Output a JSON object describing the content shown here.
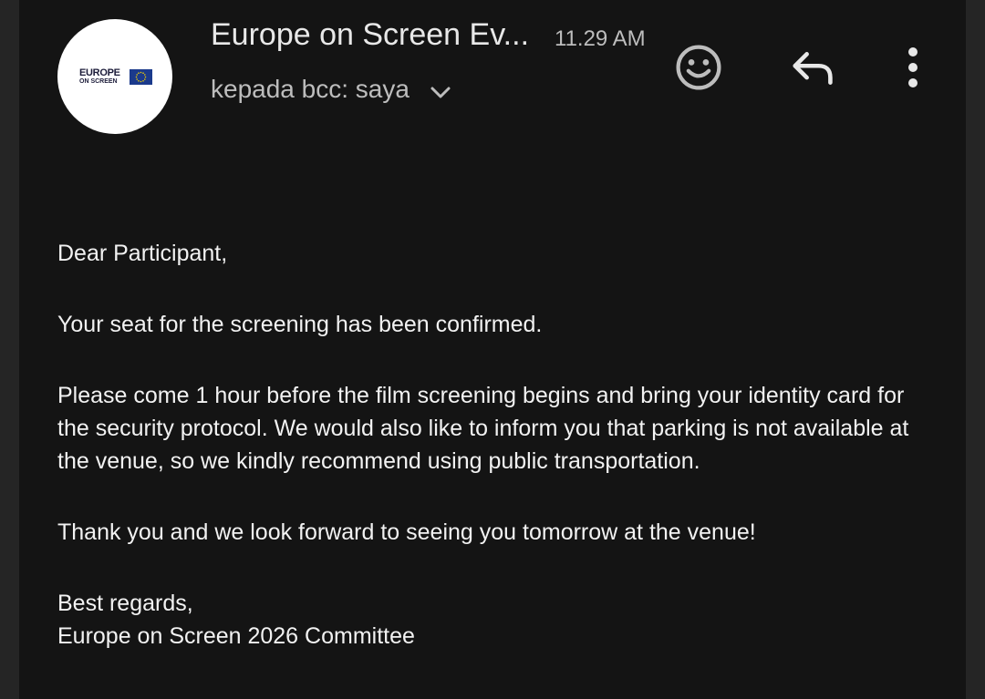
{
  "header": {
    "sender_name": "Europe on Screen Ev...",
    "time": "11.29 AM",
    "recipient": "kepada bcc: saya",
    "avatar": {
      "logo_text_line1": "EUROPE",
      "logo_text_line2": "ON SCREEN"
    }
  },
  "icons": {
    "expand": "chevron-down-icon",
    "emoji": "smiley-face-icon",
    "reply": "reply-arrow-icon",
    "more": "more-vertical-icon"
  },
  "body": {
    "greeting": "Dear Participant,",
    "paragraphs": [
      "Your seat for the screening has been confirmed.",
      "Please come 1 hour before the film screening begins and bring your identity card for the security protocol. We would also like to inform you that parking is not available at the venue, so we kindly recommend using public transportation.",
      "Thank you and we look forward to seeing you tomorrow at the venue!"
    ],
    "closing": "Best regards,",
    "signature": "Europe on Screen 2026 Committee"
  },
  "colors": {
    "background": "#141414",
    "text_primary": "#f2f2f2",
    "text_secondary": "#bdbdbd",
    "eu_blue": "#1b3a8c",
    "eu_star": "#f5d200"
  }
}
